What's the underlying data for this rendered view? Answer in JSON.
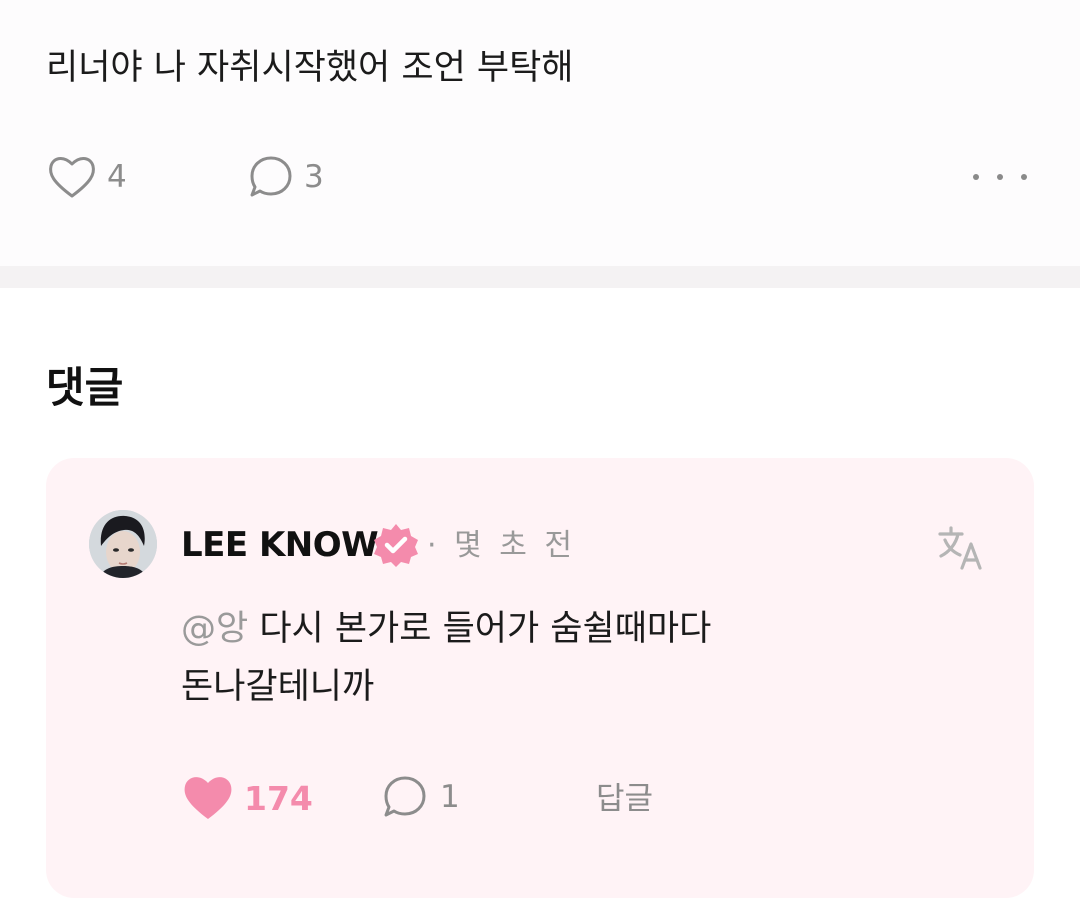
{
  "post": {
    "text": "리너야 나 자취시작했어 조언 부탁해",
    "like_count": "4",
    "comment_count": "3",
    "more_icon": "more-horizontal-icon"
  },
  "comments_section": {
    "title": "댓글"
  },
  "comment": {
    "author": "LEE KNOW",
    "verified_badge_icon": "verified-badge-icon",
    "time": "· 몇 초 전",
    "translate_icon": "translate-icon",
    "mention": "@앙",
    "body_line1": " 다시 본가로 들어가 숨쉴때마다",
    "body_line2": "돈나갈테니까",
    "like_count": "174",
    "reply_count": "1",
    "reply_label": "답글"
  },
  "colors": {
    "accent_pink": "#f48bac",
    "card_background": "#fff3f6",
    "muted_text": "#8c8c8c"
  }
}
